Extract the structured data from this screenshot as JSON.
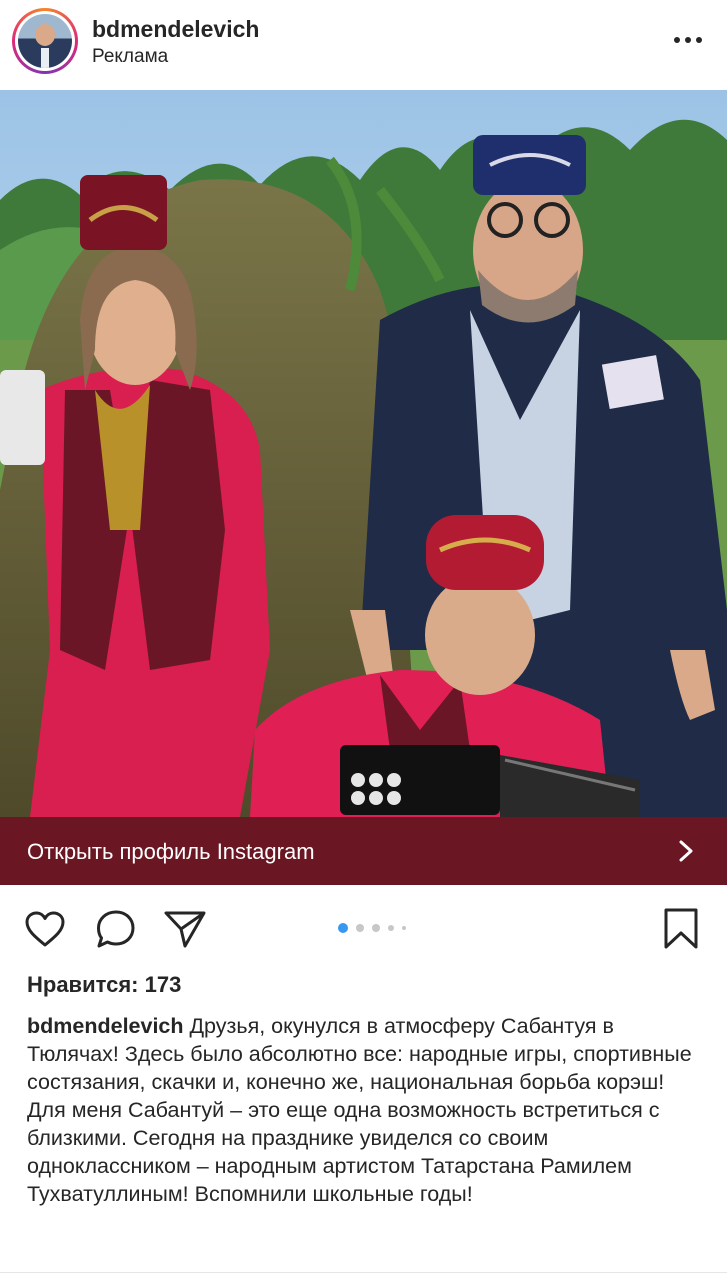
{
  "post": {
    "username": "bdmendelevich",
    "sponsored_label": "Реклама",
    "more_icon": "more-dots-icon"
  },
  "profile_bar": {
    "label": "Открыть профиль Instagram",
    "background": "#6b1623",
    "icon": "chevron-right-icon"
  },
  "actions": {
    "like_icon": "heart-icon",
    "comment_icon": "comment-icon",
    "share_icon": "paper-plane-icon",
    "save_icon": "bookmark-icon",
    "carousel_total": 5,
    "carousel_active": 1,
    "accent": "#3897f0"
  },
  "likes": {
    "text": "Нравится: 173"
  },
  "caption": {
    "username": "bdmendelevich",
    "paragraph1": "Друзья, окунулся в атмосферу Сабантуя в Тюлячах! Здесь было абсолютно все: народные игры, спортивные состязания, скачки и, конечно же, национальная борьба корэш!",
    "paragraph2": "Для меня Сабантуй – это еще одна возможность встретиться с близкими. Сегодня на празднике увиделся со своим одноклассником – народным артистом Татарстана Рамилем Тухватуллиным! Вспомнили школьные годы!"
  }
}
